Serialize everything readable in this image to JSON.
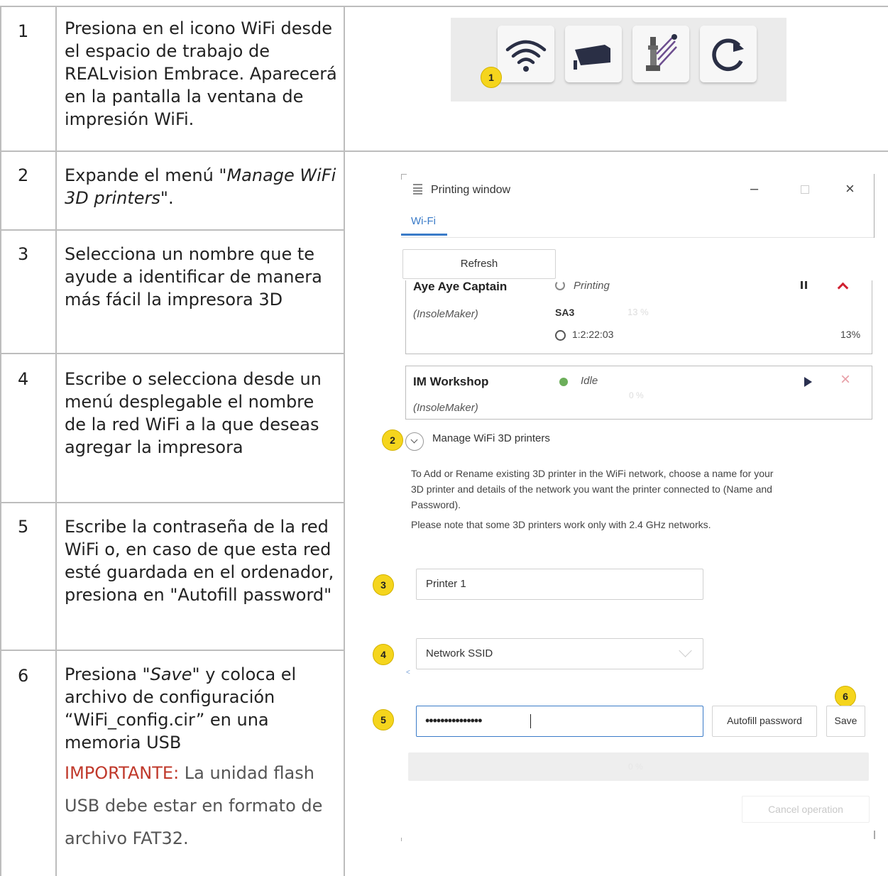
{
  "steps": [
    {
      "num": "1",
      "text": "Presiona en el icono WiFi desde el espacio de trabajo de REALvision Embrace. Aparecerá en la pantalla la ventana de impresión WiFi."
    },
    {
      "num": "2",
      "text_pre": "Expande el menú \"",
      "text_em": "Manage WiFi 3D printers",
      "text_post": "\"."
    },
    {
      "num": "3",
      "text": "Selecciona un nombre que te ayude a identificar de manera más fácil la impresora 3D"
    },
    {
      "num": "4",
      "text": "Escribe o selecciona desde un menú desplegable el nombre de la red WiFi a la que deseas agregar la impresora"
    },
    {
      "num": "5",
      "text": "Escribe la contraseña de la red WiFi o, en caso de que esta red esté guardada en el ordenador, presiona en \"Autofill password\""
    },
    {
      "num": "6",
      "text_pre": "Presiona \"",
      "text_em": "Save",
      "text_post": "\" y coloca el archivo de configuración “WiFi_config.cir” en una memoria USB",
      "important_label": "IMPORTANTE:",
      "important_text": " La unidad flash USB debe estar en formato de archivo FAT32."
    }
  ],
  "toolbar": {
    "badge": "1",
    "icons": [
      "wifi-icon",
      "camera-icon",
      "calibration-icon",
      "refresh-icon"
    ]
  },
  "window": {
    "title": "Printing window",
    "tab": "Wi-Fi",
    "refresh_label": "Refresh",
    "printers": [
      {
        "name": "Aye Aye Captain",
        "model": "(InsoleMaker)",
        "status": "Printing",
        "code": "SA3",
        "progress_text": "13 %",
        "time": "1:2:22:03",
        "percent": "13%",
        "progress": 0.13
      },
      {
        "name": "IM Workshop",
        "model": "(InsoleMaker)",
        "status": "Idle",
        "progress_text": "0 %",
        "progress": 0
      }
    ],
    "manage": {
      "badge": "2",
      "label": "Manage WiFi 3D printers",
      "desc_line1": "To Add or Rename existing 3D printer in the WiFi network, choose a name for your",
      "desc_line2": "3D printer and details of the network you want the printer connected to (Name and",
      "desc_line3": "Password).",
      "desc_line4": "Please note that some 3D printers work only with 2.4 GHz networks."
    },
    "name_badge": "3",
    "name_value": "Printer 1",
    "ssid_badge": "4",
    "ssid_value": "Network SSID",
    "password_badge": "5",
    "password_value": "•••••••••••••••",
    "autofill_label": "Autofill password",
    "save_badge": "6",
    "save_label": "Save",
    "overall_progress_text": "0 %",
    "cancel_label": "Cancel operation"
  }
}
